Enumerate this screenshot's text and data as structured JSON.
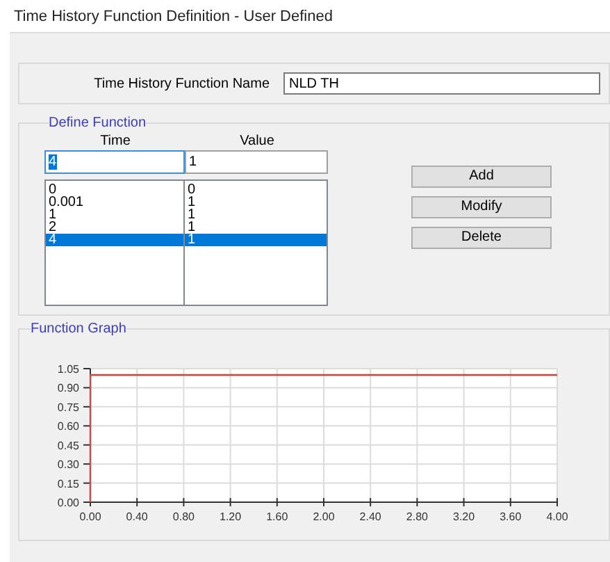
{
  "window": {
    "title": "Time History Function Definition  - User Defined"
  },
  "name_field": {
    "label": "Time History Function Name",
    "value": "NLD TH"
  },
  "define_function": {
    "title": "Define Function",
    "columns": [
      "Time",
      "Value"
    ],
    "input": {
      "time": "4",
      "value": "1"
    },
    "rows": [
      {
        "time": "0",
        "value": "0",
        "selected": false
      },
      {
        "time": "0.001",
        "value": "1",
        "selected": false
      },
      {
        "time": "1",
        "value": "1",
        "selected": false
      },
      {
        "time": "2",
        "value": "1",
        "selected": false
      },
      {
        "time": "4",
        "value": "1",
        "selected": true
      }
    ],
    "buttons": [
      "Add",
      "Modify",
      "Delete"
    ]
  },
  "graph": {
    "title": "Function Graph",
    "chart_data": {
      "type": "line",
      "x": [
        0,
        0.001,
        1,
        2,
        4
      ],
      "grid": true,
      "series": [
        {
          "color": "#c0504d",
          "values": [
            0,
            1,
            1,
            1,
            1
          ]
        }
      ],
      "xlim": [
        0,
        4
      ],
      "ylim": [
        0,
        1.05
      ],
      "xticks": [
        {
          "value": 0,
          "label": "0.00"
        },
        {
          "value": 0.4,
          "label": "0.40"
        },
        {
          "value": 0.8,
          "label": "0.80"
        },
        {
          "value": 1.2,
          "label": "1.20"
        },
        {
          "value": 1.6,
          "label": "1.60"
        },
        {
          "value": 2,
          "label": "2.00"
        },
        {
          "value": 2.4,
          "label": "2.40"
        },
        {
          "value": 2.8,
          "label": "2.80"
        },
        {
          "value": 3.2,
          "label": "3.20"
        },
        {
          "value": 3.6,
          "label": "3.60"
        },
        {
          "value": 4,
          "label": "4.00"
        }
      ],
      "yticks": [
        {
          "value": 0,
          "label": "0.00"
        },
        {
          "value": 0.15,
          "label": "0.15"
        },
        {
          "value": 0.3,
          "label": "0.30"
        },
        {
          "value": 0.45,
          "label": "0.45"
        },
        {
          "value": 0.6,
          "label": "0.60"
        },
        {
          "value": 0.75,
          "label": "0.75"
        },
        {
          "value": 0.9,
          "label": "0.90"
        },
        {
          "value": 1.05,
          "label": "1.05"
        }
      ]
    }
  }
}
